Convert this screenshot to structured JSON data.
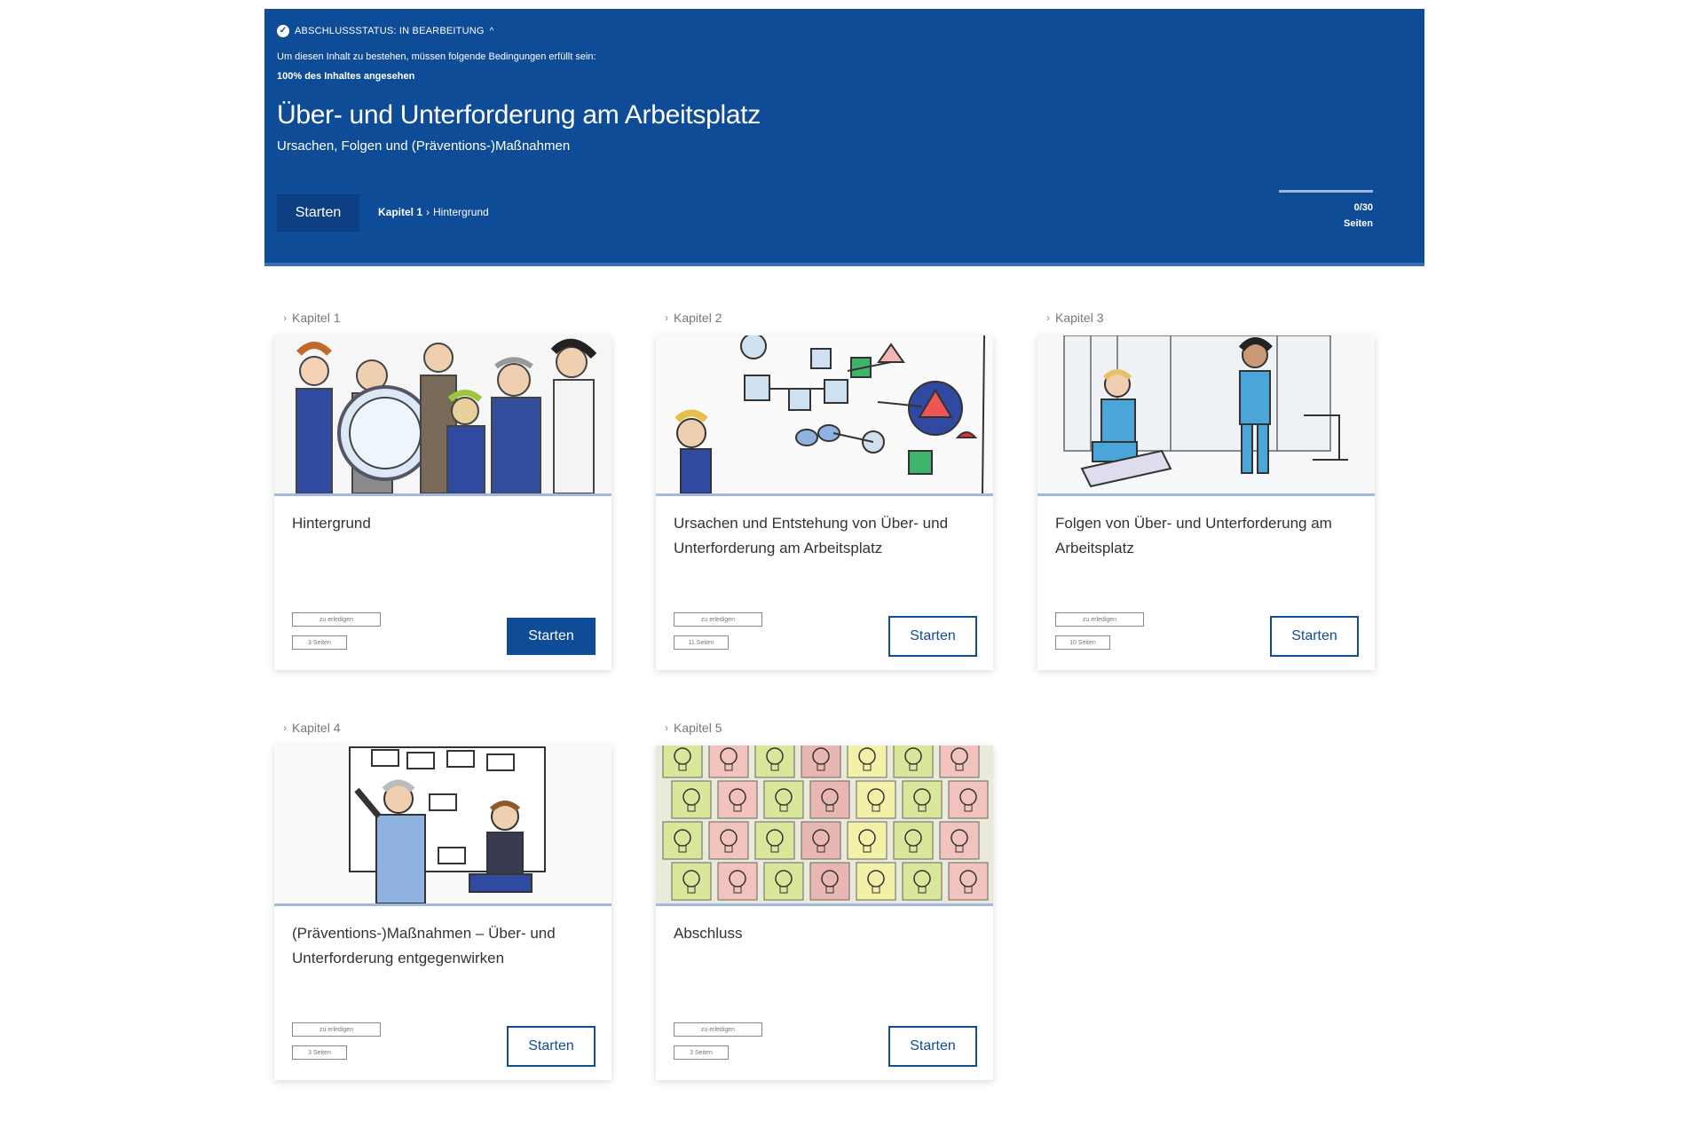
{
  "header": {
    "status_label": "ABSCHLUSSSTATUS: IN BEARBEITUNG",
    "conditions_text": "Um diesen Inhalt zu bestehen, müssen folgende Bedingungen erfüllt sein:",
    "condition_bold": "100% des Inhaltes angesehen",
    "title": "Über- und Unterforderung am Arbeitsplatz",
    "subtitle": "Ursachen, Folgen und (Präventions-)Maßnahmen",
    "start_label": "Starten",
    "breadcrumb": [
      "Kapitel 1",
      "Hintergrund"
    ],
    "progress": {
      "count": "0/30",
      "unit": "Seiten",
      "fraction": 0.0
    }
  },
  "chapters": [
    {
      "label": "Kapitel 1",
      "title": "Hintergrund",
      "tag1": "zu erledigen",
      "tag2": "3 Seiten",
      "button": "Starten",
      "image": "team-magnifier-illustration"
    },
    {
      "label": "Kapitel 2",
      "title": "Ursachen und Entstehung von Über- und Unterforderung am Arbeitsplatz",
      "tag1": "zu erledigen",
      "tag2": "11 Seiten",
      "button": "Starten",
      "image": "process-diagram-illustration"
    },
    {
      "label": "Kapitel 3",
      "title": "Folgen von Über- und Unterforderung am Arbeitsplatz",
      "tag1": "zu erledigen",
      "tag2": "10 Seiten",
      "button": "Starten",
      "image": "nurses-illustration"
    },
    {
      "label": "Kapitel 4",
      "title": "(Präventions-)Maßnahmen – Über- und Unterforderung entgegenwirken",
      "tag1": "zu erledigen",
      "tag2": "3 Seiten",
      "button": "Starten",
      "image": "whiteboard-discussion-illustration"
    },
    {
      "label": "Kapitel 5",
      "title": "Abschluss",
      "tag1": "zu erledigen",
      "tag2": "3 Seiten",
      "button": "Starten",
      "image": "lightbulb-notes-illustration"
    }
  ],
  "colors": {
    "brand": "#0f4c97",
    "banner_border": "#3a6fb5",
    "image_underline": "#9fb8dc"
  }
}
